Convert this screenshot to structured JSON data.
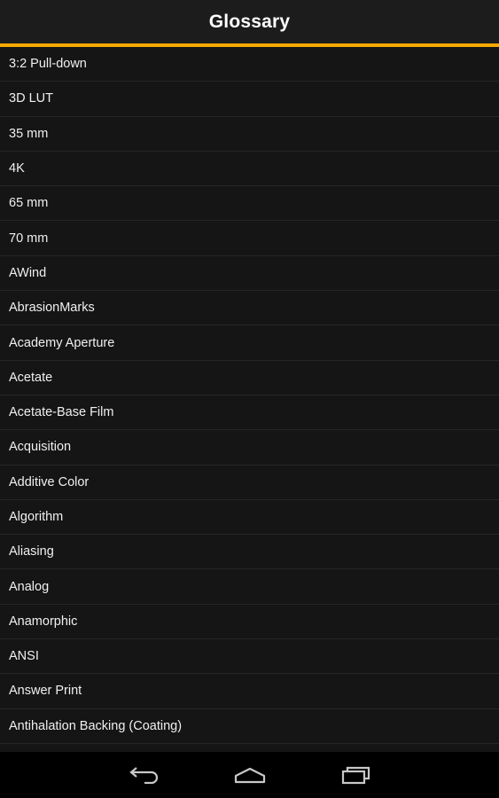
{
  "header": {
    "title": "Glossary",
    "accent_color": "#f5a800"
  },
  "glossary": {
    "items": [
      {
        "label": "3:2 Pull-down"
      },
      {
        "label": "3D LUT"
      },
      {
        "label": "35 mm"
      },
      {
        "label": "4K"
      },
      {
        "label": "65 mm"
      },
      {
        "label": "70 mm"
      },
      {
        "label": "AWind"
      },
      {
        "label": "AbrasionMarks"
      },
      {
        "label": "Academy Aperture"
      },
      {
        "label": "Acetate"
      },
      {
        "label": "Acetate-Base Film"
      },
      {
        "label": "Acquisition"
      },
      {
        "label": "Additive Color"
      },
      {
        "label": "Algorithm"
      },
      {
        "label": "Aliasing"
      },
      {
        "label": "Analog"
      },
      {
        "label": "Anamorphic"
      },
      {
        "label": "ANSI"
      },
      {
        "label": "Answer Print"
      },
      {
        "label": "Antihalation Backing (Coating)"
      },
      {
        "label": ""
      }
    ]
  },
  "navigation": {
    "back_icon": "back-icon",
    "home_icon": "home-icon",
    "recents_icon": "recents-icon"
  }
}
